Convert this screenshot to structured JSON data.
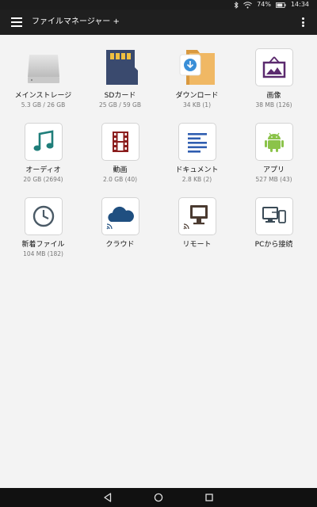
{
  "status_bar": {
    "battery_percent": "74%",
    "time": "14:34",
    "icons": [
      "bluetooth-icon",
      "wifi-icon",
      "battery-icon"
    ]
  },
  "app_bar": {
    "title": "ファイルマネージャー +",
    "icons": [
      "menu-icon",
      "overflow-menu-icon"
    ]
  },
  "tiles": [
    {
      "label": "メインストレージ",
      "sub": "5.3 GB / 26 GB",
      "icon": "internal-storage-icon"
    },
    {
      "label": "SDカード",
      "sub": "25 GB / 59 GB",
      "icon": "sd-card-icon"
    },
    {
      "label": "ダウンロード",
      "sub": "34 KB (1)",
      "icon": "download-folder-icon"
    },
    {
      "label": "画像",
      "sub": "38 MB (126)",
      "icon": "image-icon"
    },
    {
      "label": "オーディオ",
      "sub": "20 GB (2694)",
      "icon": "music-note-icon"
    },
    {
      "label": "動画",
      "sub": "2.0 GB (40)",
      "icon": "film-strip-icon"
    },
    {
      "label": "ドキュメント",
      "sub": "2.8 KB (2)",
      "icon": "document-lines-icon"
    },
    {
      "label": "アプリ",
      "sub": "527 MB (43)",
      "icon": "android-icon"
    },
    {
      "label": "新着ファイル",
      "sub": "104 MB (182)",
      "icon": "clock-icon"
    },
    {
      "label": "クラウド",
      "sub": "",
      "icon": "cloud-icon"
    },
    {
      "label": "リモート",
      "sub": "",
      "icon": "monitor-icon"
    },
    {
      "label": "PCから接続",
      "sub": "",
      "icon": "pc-connect-icon"
    }
  ],
  "nav_bar": {
    "icons": [
      "back-icon",
      "home-icon",
      "recents-icon"
    ]
  },
  "colors": {
    "status_bar": "#1c1c1c",
    "app_bar": "#1f1f1f",
    "background": "#f3f3f3",
    "image_purple": "#5b2a6e",
    "music_teal": "#1f7e7a",
    "film_red": "#8b1e1e",
    "doc_blue": "#2f5db0",
    "android_green": "#8bc34a",
    "clock_slate": "#4a5a66",
    "cloud_blue": "#1f4f80",
    "monitor_brown": "#4a3a30"
  }
}
